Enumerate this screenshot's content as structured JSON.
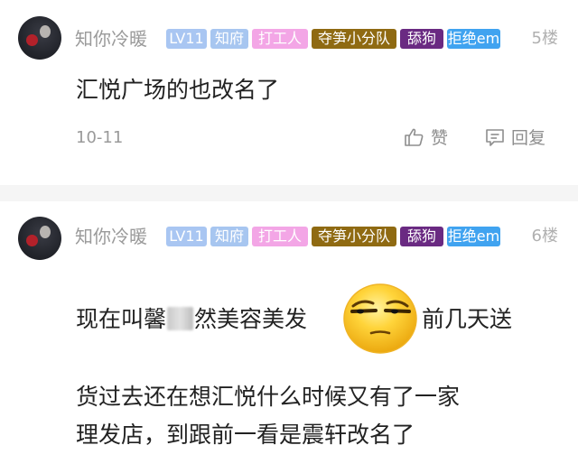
{
  "comments": [
    {
      "username": "知你冷暖",
      "tags": [
        {
          "label": "LV11",
          "color": "#a9c6f2"
        },
        {
          "label": "知府",
          "color": "#a7c6f0"
        },
        {
          "label": "打工人",
          "color": "#f3a6e6"
        },
        {
          "label": "夺笋小分队",
          "color": "#8f6a12"
        },
        {
          "label": "舔狗",
          "color": "#6a2a82"
        },
        {
          "label": "拒绝em",
          "color": "#40a3f0"
        }
      ],
      "floor": "5楼",
      "content_lines": [
        "汇悦广场的也改名了"
      ],
      "date": "10-11",
      "like_label": "赞",
      "reply_label": "回复"
    },
    {
      "username": "知你冷暖",
      "tags": [
        {
          "label": "LV11",
          "color": "#a9c6f2"
        },
        {
          "label": "知府",
          "color": "#a7c6f0"
        },
        {
          "label": "打工人",
          "color": "#f3a6e6"
        },
        {
          "label": "夺笋小分队",
          "color": "#8f6a12"
        },
        {
          "label": "舔狗",
          "color": "#6a2a82"
        },
        {
          "label": "拒绝em",
          "color": "#40a3f0"
        }
      ],
      "floor": "6楼",
      "content_parts": {
        "before_blur": "现在叫馨",
        "after_blur": "然美容美发",
        "after_emoji": "前几天送"
      },
      "content_lines": [
        "货过去还在想汇悦什么时候又有了一家",
        "理发店，到跟前一看是震轩改名了"
      ],
      "emoji_icon": "squint-face-emoji-icon"
    }
  ]
}
